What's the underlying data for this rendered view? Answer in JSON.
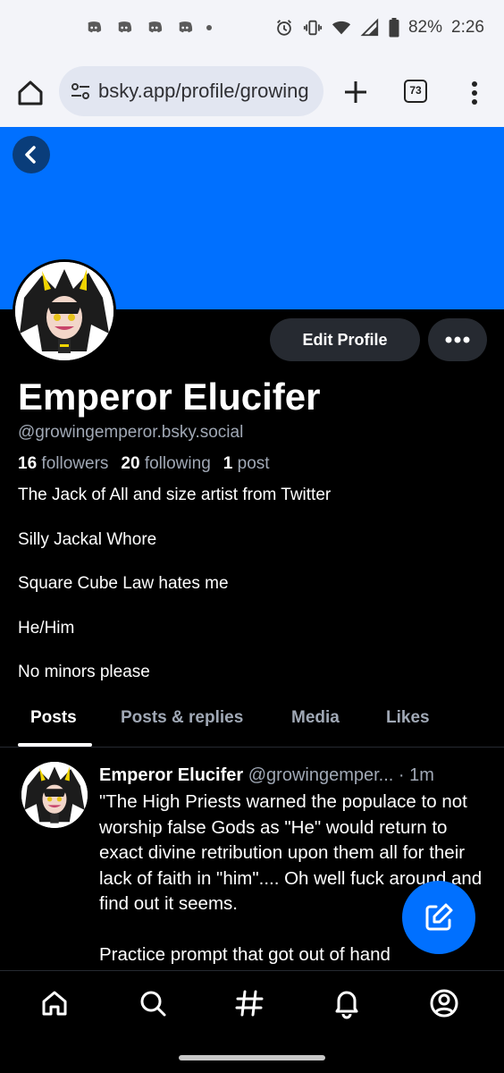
{
  "status_bar": {
    "battery": "82%",
    "time": "2:26",
    "notification_icons": [
      "discord-icon",
      "discord-icon",
      "discord-icon",
      "discord-icon"
    ]
  },
  "browser": {
    "url": "bsky.app/profile/growing",
    "tab_count": "73"
  },
  "profile": {
    "banner_color": "#0070ff",
    "edit_label": "Edit Profile",
    "display_name": "Emperor Elucifer",
    "handle": "@growingemperor.bsky.social",
    "followers_count": "16",
    "followers_label": "followers",
    "following_count": "20",
    "following_label": "following",
    "posts_count": "1",
    "posts_label": "post",
    "bio": [
      "The Jack of All and size artist from Twitter",
      "Silly Jackal Whore",
      "Square Cube Law hates me",
      "He/Him",
      "No minors please"
    ]
  },
  "tabs": [
    {
      "label": "Posts",
      "active": true
    },
    {
      "label": "Posts & replies",
      "active": false
    },
    {
      "label": "Media",
      "active": false
    },
    {
      "label": "Likes",
      "active": false
    }
  ],
  "post": {
    "author": "Emperor Elucifer",
    "handle": "@growingemper...",
    "separator": "·",
    "time": "1m",
    "paragraphs": [
      "\"The High Priests warned the populace to not worship false Gods as \"He\" would return to exact divine retribution upon them all for their lack of faith in \"him\".... Oh well fuck around and find out it seems.",
      "Practice prompt that got out of hand"
    ]
  },
  "bottom_nav": [
    "home-icon",
    "search-icon",
    "feeds-hashtag-icon",
    "notifications-bell-icon",
    "profile-icon"
  ],
  "colors": {
    "accent": "#0070ff",
    "muted_text": "#a0a8b5",
    "button_bg": "#262a31"
  }
}
